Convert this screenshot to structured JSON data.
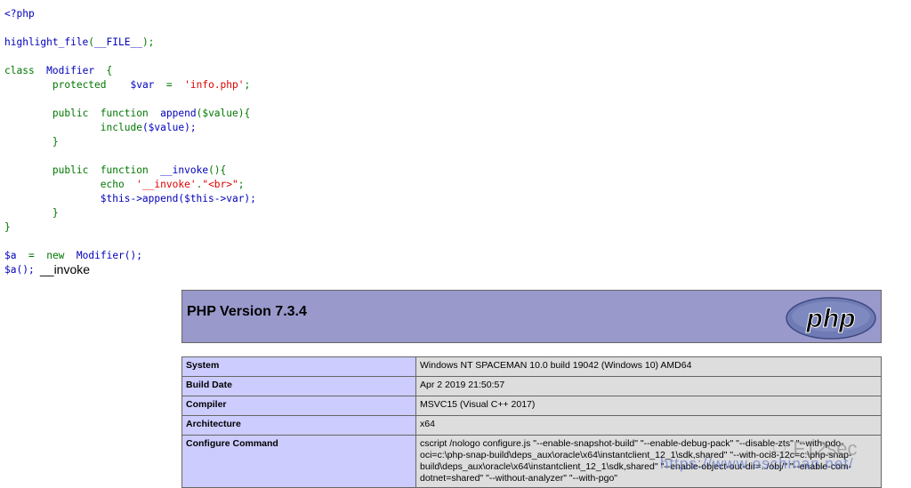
{
  "code": {
    "open_tag": "<?php",
    "fn_highlight": "highlight_file",
    "paren_open": "(",
    "file_const": "__FILE__",
    "paren_close_semi": ");",
    "kw_class": "class",
    "class_name": "Modifier",
    "brace_open": "{",
    "kw_protected": "protected",
    "var_name": "$var",
    "assign_op": "=",
    "str_info": "'info.php'",
    "semi": ";",
    "kw_public": "public",
    "kw_function": "function",
    "fn_append": "append",
    "param_value": "($value){",
    "kw_include": "include",
    "include_arg": "($value);",
    "brace_close": "}",
    "fn_invoke": "__invoke",
    "invoke_parens": "(){",
    "kw_echo": "echo",
    "str_invoke": "'__invoke'",
    "dot": ".",
    "str_br": "\"<br>\"",
    "this_append": "$this->append($this->var);",
    "var_a": "$a",
    "kw_new": "new",
    "new_class": "Modifier();",
    "call_a": "$a();"
  },
  "output_text": "__invoke",
  "phpinfo": {
    "title": "PHP Version 7.3.4",
    "logo_text": "php",
    "rows": [
      {
        "key": "System",
        "value": "Windows NT SPACEMAN 10.0 build 19042 (Windows 10) AMD64"
      },
      {
        "key": "Build Date",
        "value": "Apr 2 2019 21:50:57"
      },
      {
        "key": "Compiler",
        "value": "MSVC15 (Visual C++ 2017)"
      },
      {
        "key": "Architecture",
        "value": "x64"
      },
      {
        "key": "Configure Command",
        "value": "cscript /nologo configure.js \"--enable-snapshot-build\" \"--enable-debug-pack\" \"--disable-zts\" \"--with-pdo-oci=c:\\php-snap-build\\deps_aux\\oracle\\x64\\instantclient_12_1\\sdk,shared\" \"--with-oci8-12c=c:\\php-snap-build\\deps_aux\\oracle\\x64\\instantclient_12_1\\sdk,shared\" \"--enable-object-out-dir=../obj/\" \"--enable-com-dotnet=shared\" \"--without-analyzer\" \"--with-pgo\""
      }
    ]
  },
  "watermark": {
    "url": "https://www.oschinan.net/",
    "brand": "F12sec"
  },
  "colors": {
    "keyword": "#007700",
    "default": "#0000BB",
    "string": "#DD0000",
    "header_bg": "#9999cc",
    "key_bg": "#ccccff",
    "value_bg": "#dddddd"
  }
}
